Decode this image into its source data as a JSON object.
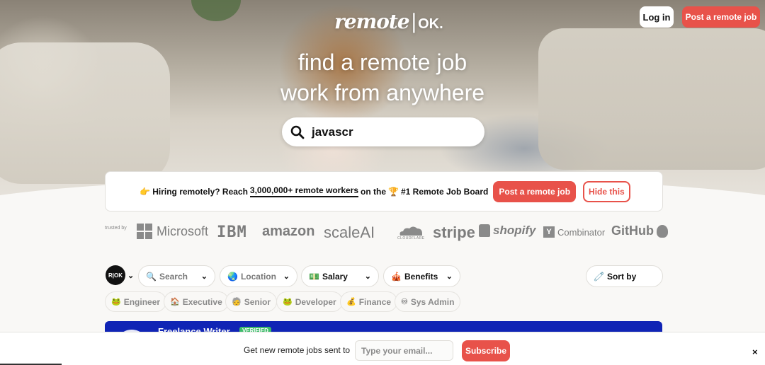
{
  "header": {
    "logo_text": "remote",
    "logo_sep": "|",
    "logo_ok": "OK.",
    "login_label": "Log in",
    "post_job_label": "Post a remote job"
  },
  "hero": {
    "headline_line1": "find a remote job",
    "headline_line2": "work from anywhere",
    "search_value": "javascr",
    "search_icon": "search-icon"
  },
  "banner": {
    "emoji_hand": "👉",
    "text_before": "Hiring remotely? Reach",
    "highlight": "3,000,000+ remote workers",
    "text_after": "on the",
    "emoji_trophy": "🏆",
    "text_end": "#1 Remote Job Board",
    "post_label": "Post a remote job",
    "hide_label": "Hide this"
  },
  "trusted": {
    "label": "trusted by",
    "logos": [
      "Microsoft",
      "IBM",
      "amazon",
      "scaleAI",
      "CLOUDFLARE",
      "stripe",
      "shopify",
      "Combinator",
      "GitHub"
    ]
  },
  "filters": {
    "rok_label": "R|OK",
    "search": "Search",
    "location": "Location",
    "salary": "Salary",
    "benefits": "Benefits",
    "sort": "Sort by"
  },
  "tags": [
    {
      "icon": "🐸",
      "label": "Engineer"
    },
    {
      "icon": "🏠",
      "label": "Executive"
    },
    {
      "icon": "🧓",
      "label": "Senior"
    },
    {
      "icon": "🐸",
      "label": "Developer"
    },
    {
      "icon": "💰",
      "label": "Finance"
    },
    {
      "icon": "♾",
      "label": "Sys Admin"
    }
  ],
  "job": {
    "title": "Freelance Writer",
    "badge": "VERIFIED"
  },
  "footer": {
    "label": "Get new remote jobs sent to",
    "email_placeholder": "Type your email...",
    "subscribe": "Subscribe",
    "close": "×"
  },
  "colors": {
    "accent": "#e8524a",
    "job_card": "#1024b5"
  }
}
